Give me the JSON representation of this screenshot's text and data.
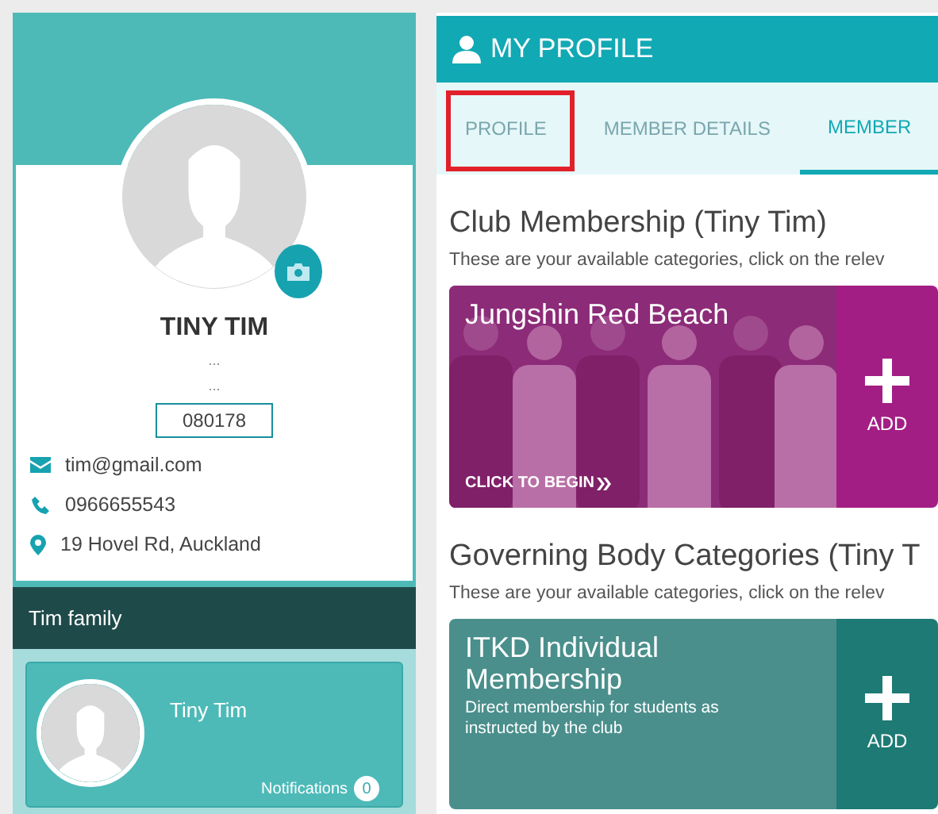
{
  "profile": {
    "name": "TINY TIM",
    "line_1": "...",
    "line_2": "...",
    "member_id": "080178",
    "email": "tim@gmail.com",
    "phone": "0966655543",
    "address": "19 Hovel Rd, Auckland"
  },
  "family": {
    "title": "Tim family",
    "members": [
      {
        "name": "Tiny Tim",
        "notifications_label": "Notifications",
        "notifications_count": "0"
      }
    ]
  },
  "header": {
    "title": "MY PROFILE"
  },
  "tabs": [
    {
      "label": "PROFILE",
      "selected": false,
      "highlighted": true
    },
    {
      "label": "MEMBER DETAILS",
      "selected": false,
      "highlighted": false
    },
    {
      "label": "MEMBER",
      "selected": true,
      "highlighted": false
    }
  ],
  "sections": [
    {
      "title": "Club Membership (Tiny Tim)",
      "subtitle": "These are your available categories, click on the relev",
      "cards": [
        {
          "kind": "picture",
          "title": "Jungshin Red Beach",
          "cta": "CLICK TO BEGIN",
          "add_label": "ADD"
        }
      ]
    },
    {
      "title": "Governing Body Categories (Tiny T",
      "subtitle": "These are your available categories, click on the relev",
      "cards": [
        {
          "kind": "plain",
          "title": "ITKD Individual Membership",
          "description": "Direct membership for students as instructed by the club",
          "add_label": "ADD"
        }
      ]
    }
  ]
}
